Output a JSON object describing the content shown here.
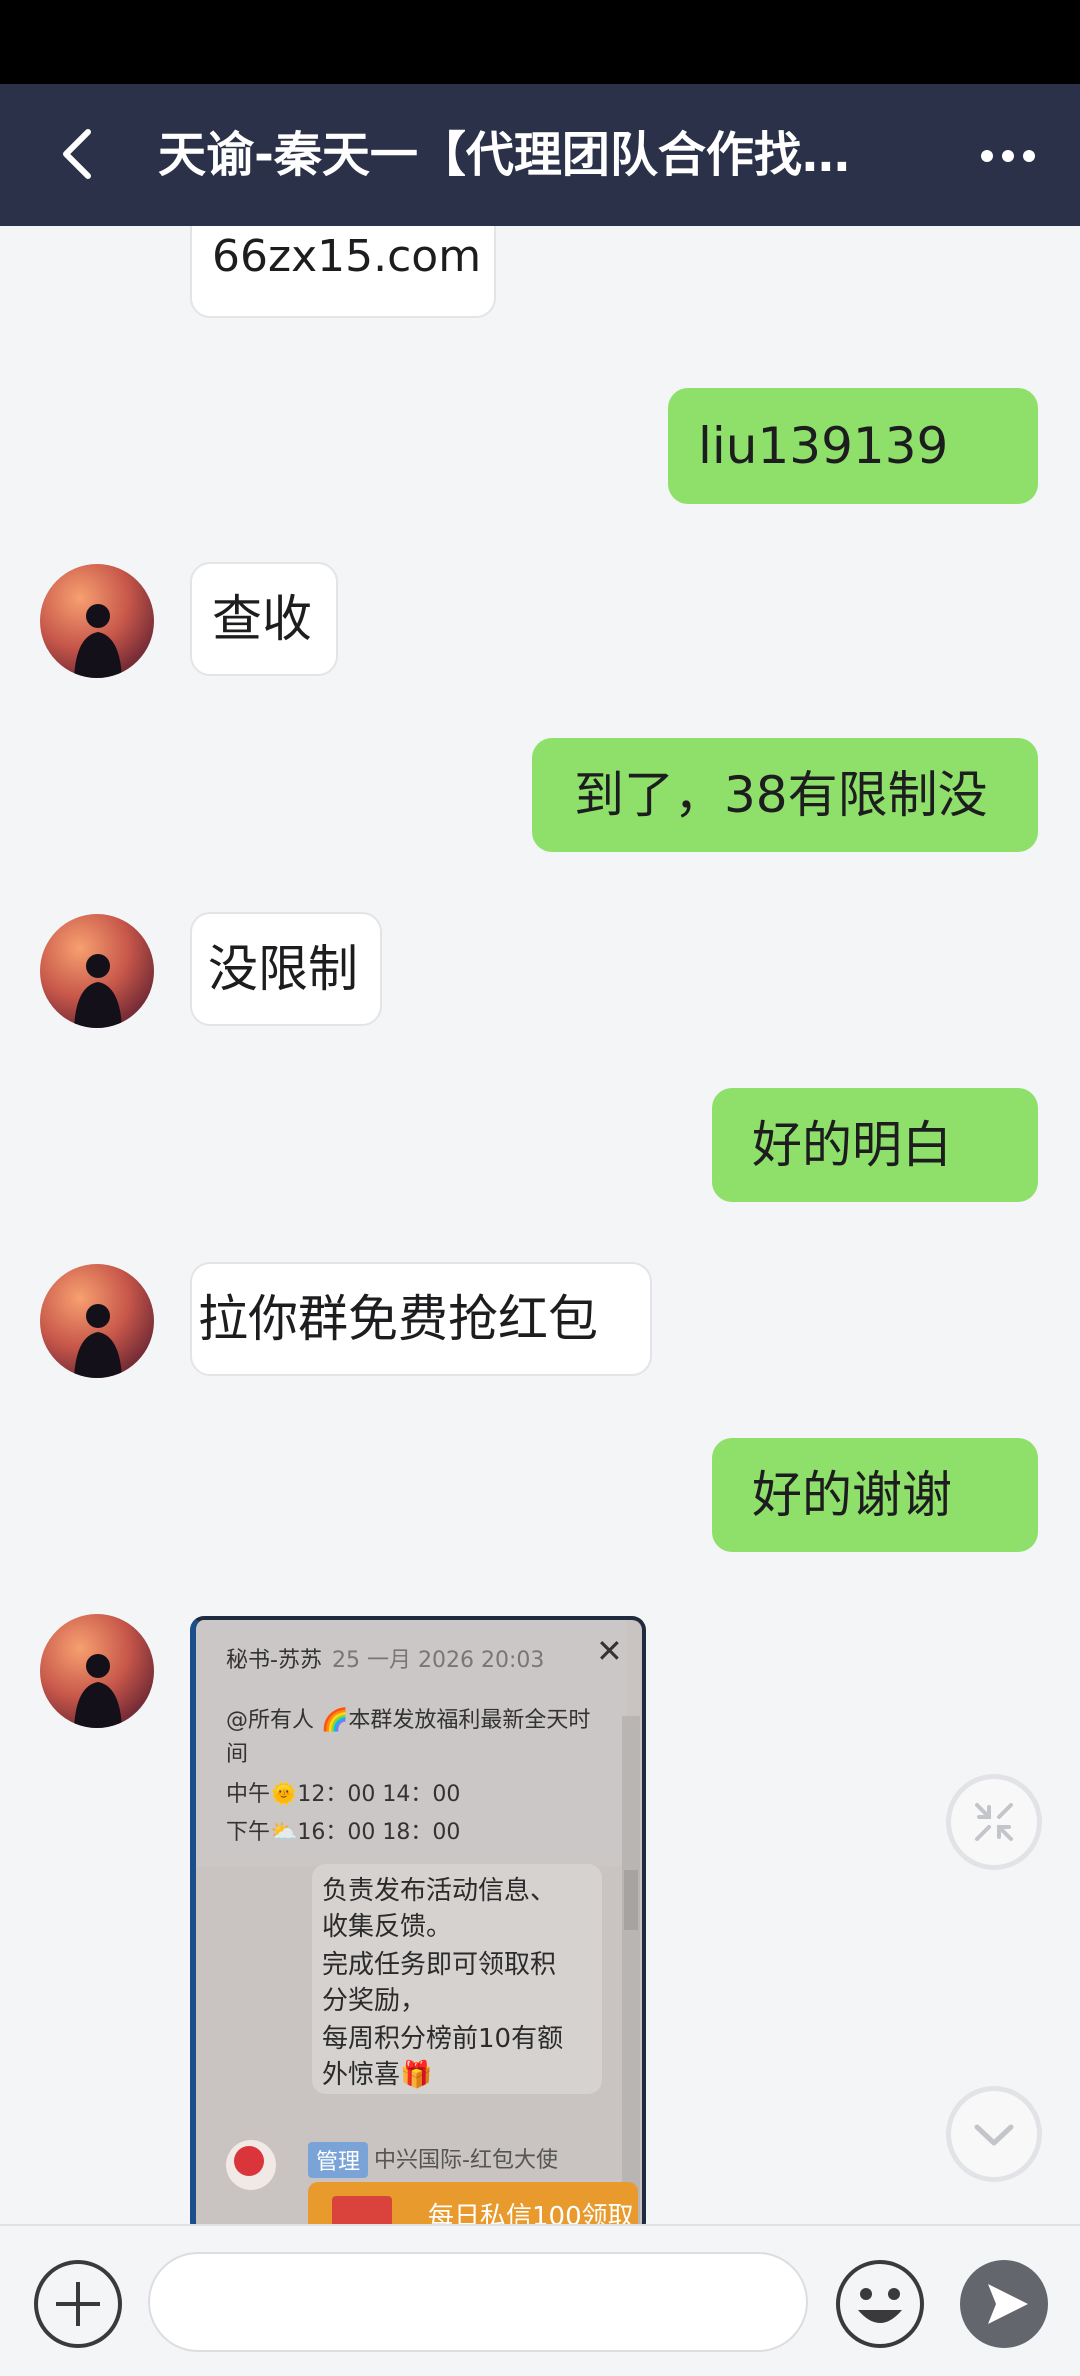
{
  "header": {
    "title": "天谕-秦天一【代理团队合作找…",
    "back_icon": "back-arrow-icon",
    "more_icon": "more-icon"
  },
  "messages": [
    {
      "side": "left",
      "text": "66zx15.com"
    },
    {
      "side": "right",
      "text": "liu139139"
    },
    {
      "side": "left",
      "text": "查收"
    },
    {
      "side": "right",
      "text": "到了，38有限制没"
    },
    {
      "side": "left",
      "text": "没限制"
    },
    {
      "side": "right",
      "text": "好的明白"
    },
    {
      "side": "left",
      "text": "拉你群免费抢红包"
    },
    {
      "side": "right",
      "text": "好的谢谢"
    }
  ],
  "screenshot": {
    "sender": "秘书-苏苏",
    "date": "25 一月 2026 20:03",
    "line1": "@所有人 🌈本群发放福利最新全天时",
    "line2": "间",
    "line3": "中午🌞12：00 14：00",
    "line4": "下午⛅16：00 18：00",
    "body1": "负责发布活动信息、",
    "body2": "收集反馈。",
    "body3": "完成任务即可领取积",
    "body4": "分奖励，",
    "body5": "每周积分榜前10有额",
    "body6": "外惊喜🎁",
    "badge": "管理",
    "sender2": "中兴国际-红包大使",
    "red_text": "每日私信100领取"
  },
  "input": {
    "placeholder": ""
  },
  "colors": {
    "header_bg": "#2b3148",
    "right_bubble": "#8ee06a",
    "left_bubble": "#ffffff",
    "background": "#f4f5f7"
  }
}
